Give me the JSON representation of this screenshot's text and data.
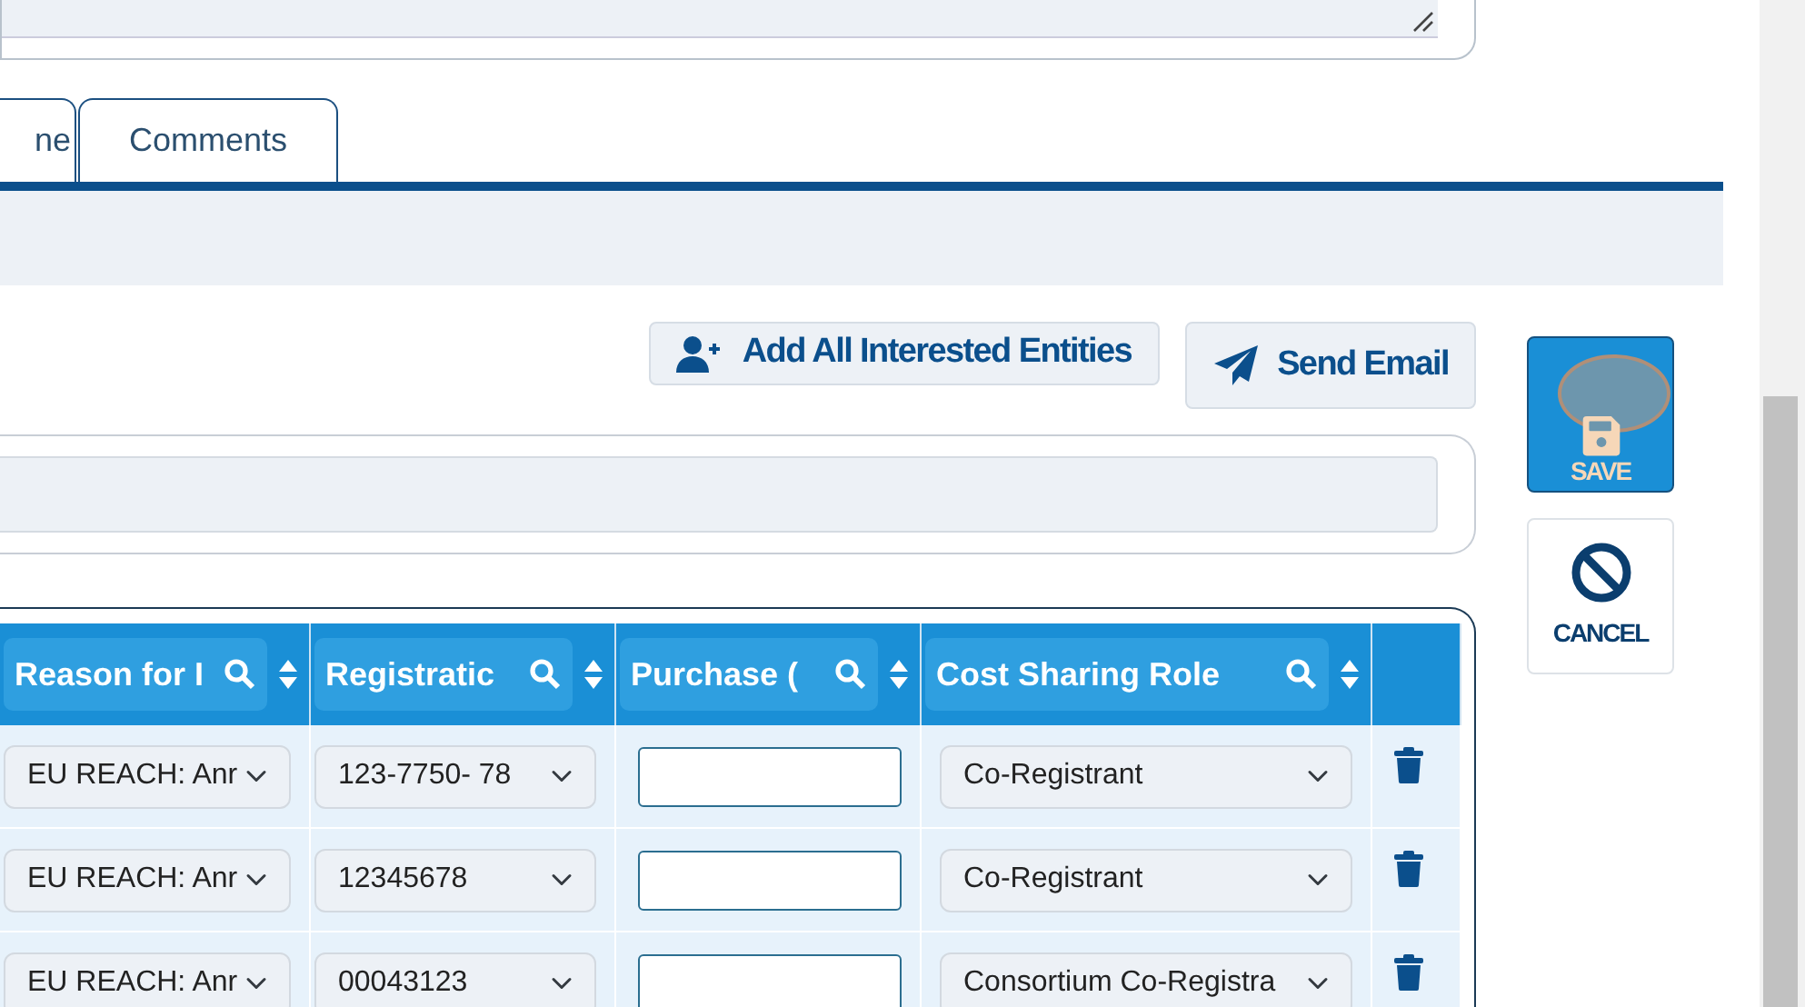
{
  "tabs": [
    {
      "label": "ne",
      "selected": false
    },
    {
      "label": "Comments",
      "selected": false
    }
  ],
  "actions": [
    {
      "label": "Add All Interested Entities",
      "kind": "add-user"
    },
    {
      "label": "Send Email",
      "kind": "send"
    }
  ],
  "side_buttons": [
    {
      "label": "SAVE",
      "kind": "save"
    },
    {
      "label": "CANCEL",
      "kind": "cancel"
    }
  ],
  "table": {
    "columns": [
      "Reason for I",
      "Registratic",
      "Purchase (",
      "Cost Sharing Role"
    ],
    "rows": [
      {
        "reason": "EU REACH: Anr",
        "registration": "123-7750- 78",
        "role": "Co-Registrant"
      },
      {
        "reason": "EU REACH: Anr",
        "registration": "12345678",
        "role": "Co-Registrant"
      },
      {
        "reason": "EU REACH: Anr",
        "registration": "00043123",
        "role": "Consortium Co-Registra"
      }
    ]
  }
}
